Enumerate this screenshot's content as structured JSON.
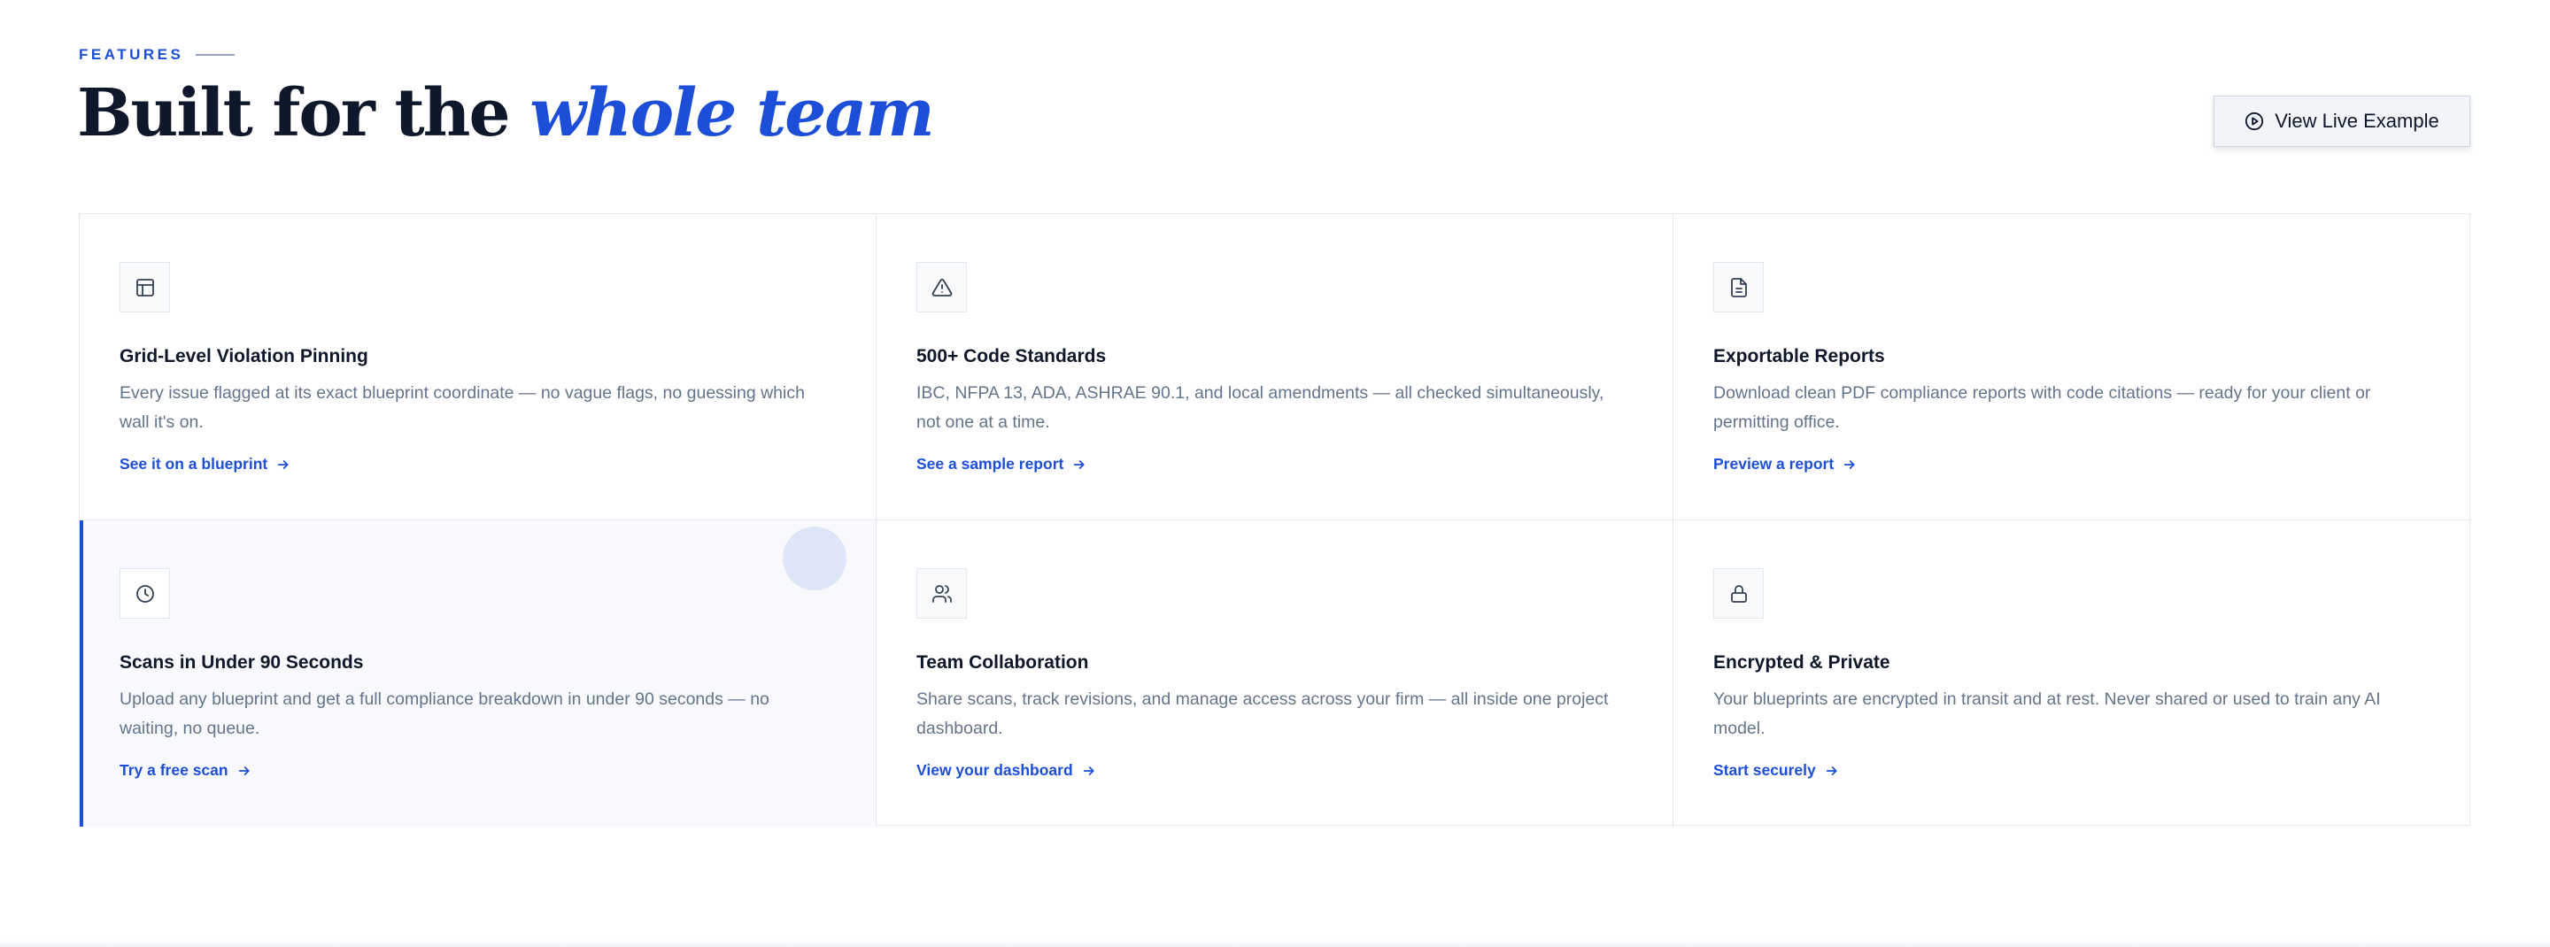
{
  "header": {
    "eyebrow": "Features",
    "title_main": "Built for the ",
    "title_accent": "whole team",
    "live_button_label": "View Live Example"
  },
  "colors": {
    "accent": "#1d4ed8",
    "text": "#0f172a",
    "muted": "#64748b",
    "active_bg": "#f7f9fc"
  },
  "features": [
    {
      "icon": "layout-grid-icon",
      "title": "Grid-Level Violation Pinning",
      "description": "Every issue flagged at its exact blueprint coordinate — no vague flags, no guessing which wall it's on.",
      "link": "See it on a blueprint"
    },
    {
      "icon": "warning-triangle-icon",
      "title": "500+ Code Standards",
      "description": "IBC, NFPA 13, ADA, ASHRAE 90.1, and local amendments — all checked simultaneously, not one at a time.",
      "link": "See a sample report"
    },
    {
      "icon": "document-icon",
      "title": "Exportable Reports",
      "description": "Download clean PDF compliance reports with code citations — ready for your client or permitting office.",
      "link": "Preview a report"
    },
    {
      "icon": "clock-icon",
      "title": "Scans in Under 90 Seconds",
      "description": "Upload any blueprint and get a full compliance breakdown in under 90 seconds — no waiting, no queue.",
      "link": "Try a free scan"
    },
    {
      "icon": "users-icon",
      "title": "Team Collaboration",
      "description": "Share scans, track revisions, and manage access across your firm — all inside one project dashboard.",
      "link": "View your dashboard"
    },
    {
      "icon": "lock-icon",
      "title": "Encrypted & Private",
      "description": "Your blueprints are encrypted in transit and at rest. Never shared or used to train any AI model.",
      "link": "Start securely"
    }
  ]
}
